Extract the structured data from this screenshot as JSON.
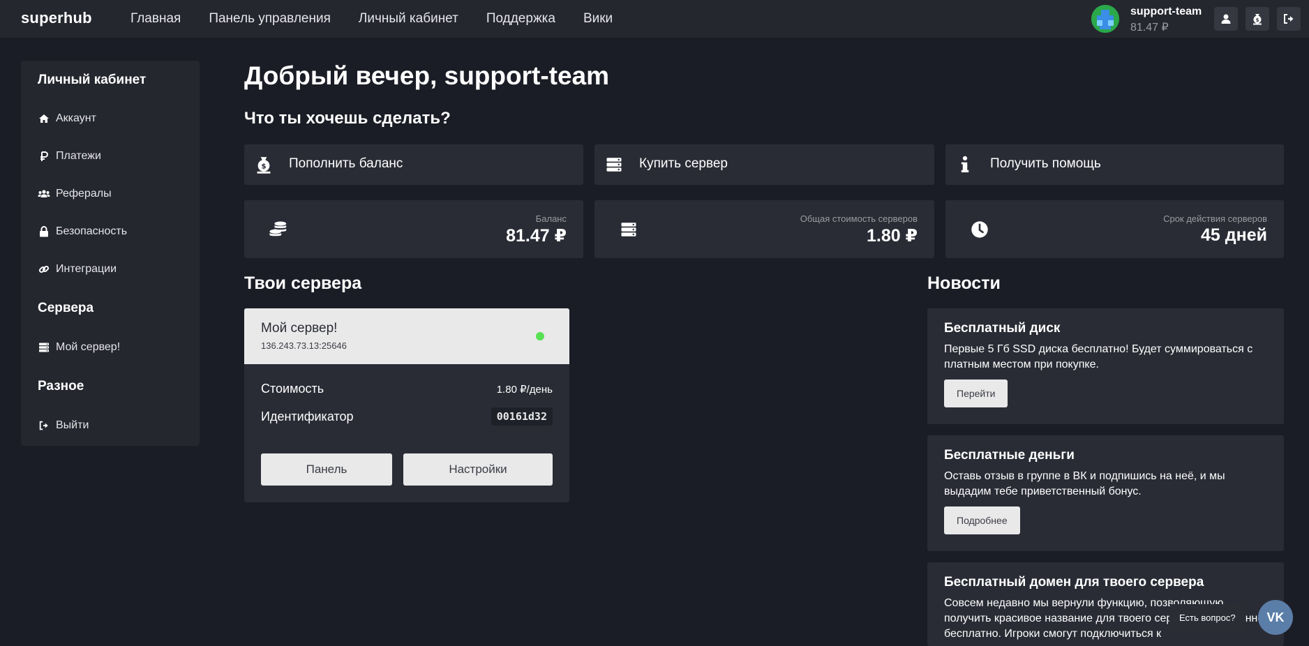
{
  "nav": {
    "brand": "superhub",
    "links": [
      "Главная",
      "Панель управления",
      "Личный кабинет",
      "Поддержка",
      "Вики"
    ],
    "user_name": "support-team",
    "user_balance": "81.47 ₽",
    "icons": [
      "user-icon",
      "money-bag-icon",
      "sign-out-icon"
    ]
  },
  "sidebar": {
    "sections": [
      {
        "heading": "Личный кабинет",
        "items": [
          {
            "label": "Аккаунт",
            "icon": "home-icon"
          },
          {
            "label": "Платежи",
            "icon": "ruble-icon"
          },
          {
            "label": "Рефералы",
            "icon": "users-icon"
          },
          {
            "label": "Безопасность",
            "icon": "lock-icon"
          },
          {
            "label": "Интеграции",
            "icon": "link-icon"
          }
        ]
      },
      {
        "heading": "Сервера",
        "items": [
          {
            "label": "Мой сервер!",
            "icon": "server-icon"
          }
        ]
      },
      {
        "heading": "Разное",
        "items": [
          {
            "label": "Выйти",
            "icon": "sign-out-icon"
          }
        ]
      }
    ]
  },
  "main": {
    "greeting": "Добрый вечер, support-team",
    "question": "Что ты хочешь сделать?",
    "actions": [
      {
        "label": "Пополнить баланс",
        "icon": "money-bag-icon"
      },
      {
        "label": "Купить сервер",
        "icon": "server-icon"
      },
      {
        "label": "Получить помощь",
        "icon": "info-icon"
      }
    ],
    "stats": [
      {
        "label": "Баланс",
        "value": "81.47 ₽",
        "icon": "coins-icon"
      },
      {
        "label": "Общая стоимость серверов",
        "value": "1.80 ₽",
        "icon": "server-icon"
      },
      {
        "label": "Срок действия серверов",
        "value": "45 дней",
        "icon": "clock-icon"
      }
    ]
  },
  "servers": {
    "title": "Твои сервера",
    "items": [
      {
        "name": "Мой сервер!",
        "ip": "136.243.73.13:25646",
        "status_color": "#58e152",
        "cost_label": "Стоимость",
        "cost_value": "1.80 ₽/день",
        "id_label": "Идентификатор",
        "id_value": "00161d32",
        "panel_button": "Панель",
        "settings_button": "Настройки"
      }
    ]
  },
  "news": {
    "title": "Новости",
    "items": [
      {
        "title": "Бесплатный диск",
        "text": "Первые 5 Гб SSD диска бесплатно! Будет суммироваться с платным местом при покупке.",
        "button": "Перейти"
      },
      {
        "title": "Бесплатные деньги",
        "text": "Оставь отзыв в группе в ВК и подпишись на неё, и мы выдадим тебе приветственный бонус.",
        "button": "Подробнее"
      },
      {
        "title": "Бесплатный домен для твоего сервера",
        "text": "Совсем недавно мы вернули функцию, позволяющую получить красивое название для твоего сервера совершенно бесплатно. Игроки смогут подключиться к"
      }
    ]
  },
  "widget": {
    "tooltip": "Есть вопрос?",
    "vk_label": "VK"
  },
  "colors": {
    "background": "#1b1d26",
    "card": "#2a2c35",
    "navbar": "#25272f",
    "status_online": "#58e152",
    "vk": "#5b7ea8"
  }
}
